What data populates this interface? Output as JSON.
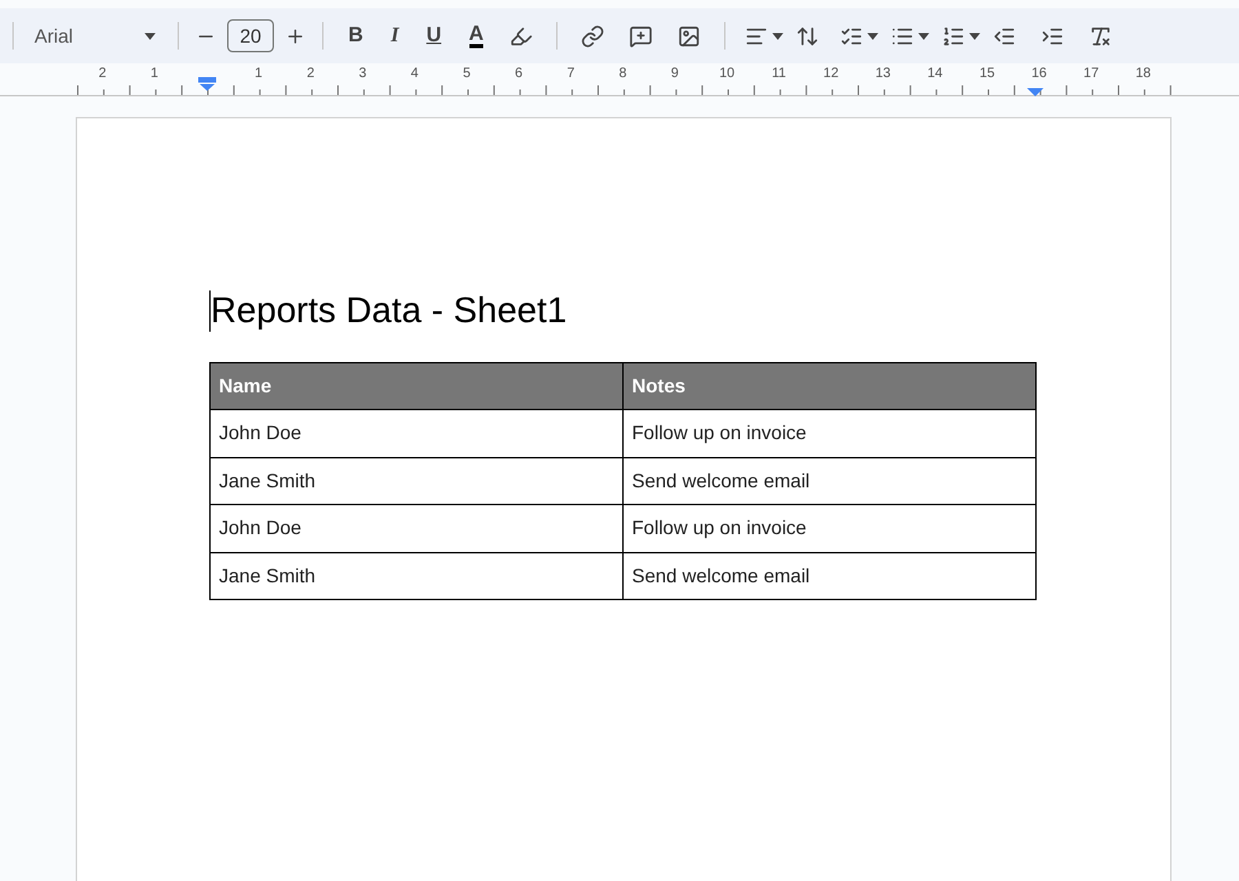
{
  "toolbar": {
    "font": "Arial",
    "font_size": "20",
    "format_buttons": [
      {
        "label": "B",
        "kind": "bold"
      },
      {
        "label": "I",
        "kind": "italic"
      },
      {
        "label": "U",
        "kind": "underline"
      },
      {
        "label": "A",
        "kind": "color"
      }
    ]
  },
  "ruler": {
    "left_labels": [
      "2",
      "1"
    ],
    "right_labels": [
      "1",
      "2",
      "3",
      "4",
      "5",
      "6",
      "7",
      "8",
      "9",
      "10",
      "11",
      "12",
      "13",
      "14",
      "15",
      "16",
      "17",
      "18"
    ]
  },
  "document": {
    "title": "Reports Data - Sheet1",
    "table": {
      "columns": [
        "Name",
        "Notes"
      ],
      "rows": [
        [
          "John Doe",
          "Follow up on invoice"
        ],
        [
          "Jane Smith",
          "Send welcome email"
        ],
        [
          "John Doe",
          "Follow up on invoice"
        ],
        [
          "Jane Smith",
          "Send welcome email"
        ]
      ]
    }
  }
}
